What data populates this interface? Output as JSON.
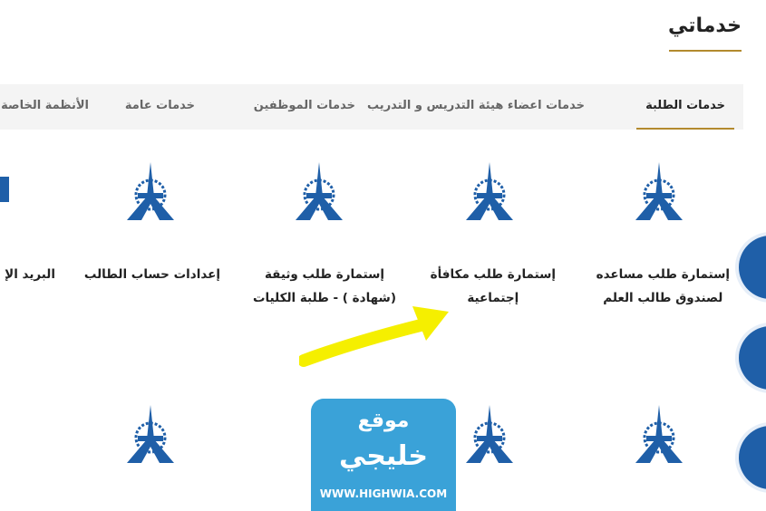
{
  "page": {
    "title": "خدماتي"
  },
  "tabs": [
    {
      "label": "خدمات الطلبة",
      "active": true
    },
    {
      "label": "خدمات اعضاء هيئة التدريس و التدريب",
      "active": false
    },
    {
      "label": "خدمات الموظفين",
      "active": false
    },
    {
      "label": "خدمات عامة",
      "active": false
    },
    {
      "label": "الأنظمة الخاصة بالم",
      "active": false
    }
  ],
  "services_row1": [
    {
      "line1": "إستمارة طلب مساعده",
      "line2": "لصندوق طالب العلم"
    },
    {
      "line1": "إستمارة طلب مكافأة",
      "line2": "إجتماعية"
    },
    {
      "line1": "إستمارة طلب وثيقة",
      "line2": "(شهادة ) - طلبة الكليات"
    },
    {
      "line1": "إعدادات حساب الطالب",
      "line2": ""
    },
    {
      "line1": "البريد الإ",
      "line2": ""
    }
  ],
  "watermark": {
    "top": "موقع",
    "main": "خليجي",
    "url": "WWW.HIGHWIA.COM"
  },
  "colors": {
    "accent": "#b38a2e",
    "primary": "#1f5fa8",
    "arrow": "#f5ef00",
    "badge": "#3aa2d8"
  },
  "icons": {
    "service": "paaet-logo-icon",
    "arrow": "yellow-arrow-annotation"
  }
}
